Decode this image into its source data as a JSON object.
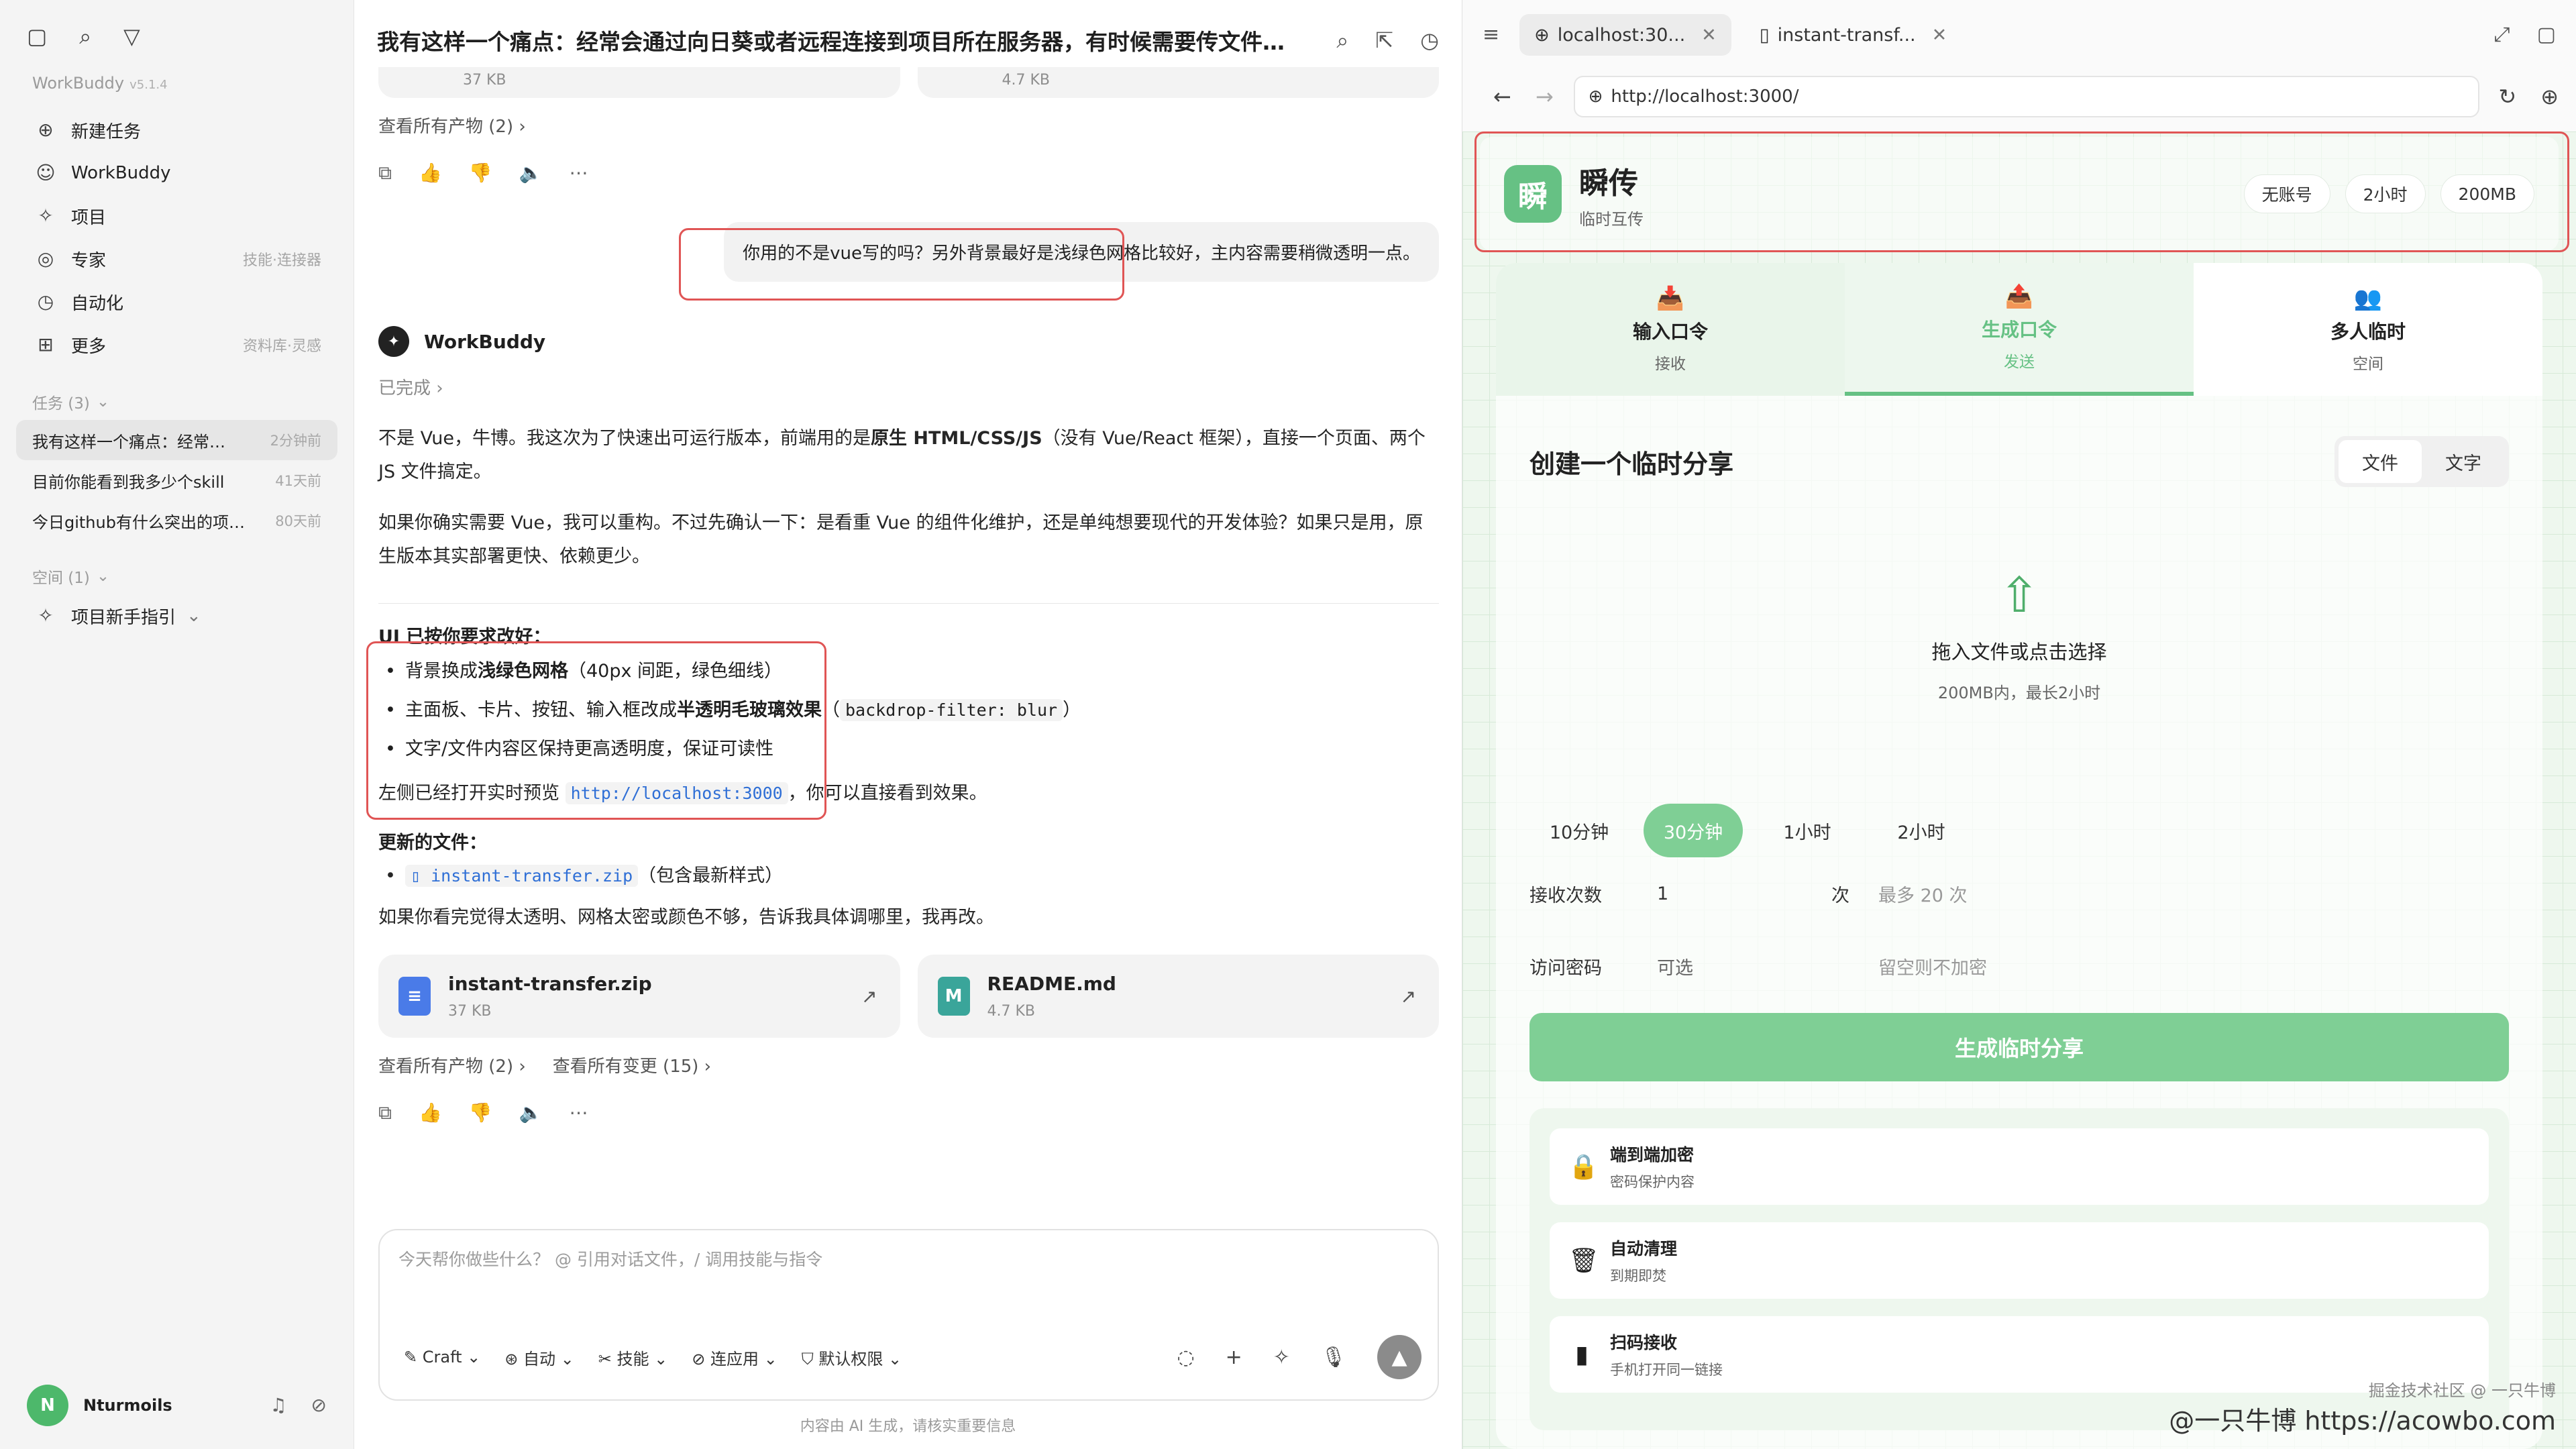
{
  "sidebar": {
    "brand": "WorkBuddy",
    "version": "v5.1.4",
    "nav": [
      {
        "label": "新建任务",
        "meta": ""
      },
      {
        "label": "WorkBuddy",
        "meta": ""
      },
      {
        "label": "项目",
        "meta": ""
      },
      {
        "label": "专家",
        "meta": "技能·连接器"
      },
      {
        "label": "自动化",
        "meta": ""
      },
      {
        "label": "更多",
        "meta": "资料库·灵感"
      }
    ],
    "tasks_header": "任务 (3)",
    "tasks": [
      {
        "title": "我有这样一个痛点：经常…",
        "time": "2分钟前"
      },
      {
        "title": "目前你能看到我多少个skill",
        "time": "41天前"
      },
      {
        "title": "今日github有什么突出的项…",
        "time": "80天前"
      }
    ],
    "space_header": "空间 (1)",
    "space_item": "项目新手指引",
    "user": "Nturmoils"
  },
  "chat": {
    "title": "我有这样一个痛点：经常会通过向日葵或者远程连接到项目所在服务器，有时候需要传文件…",
    "top_files": [
      {
        "size": "37 KB"
      },
      {
        "size": "4.7 KB"
      }
    ],
    "view_artifacts": "查看所有产物 (2)",
    "user_message": "你用的不是vue写的吗？另外背景最好是浅绿色网格比较好，主内容需要稍微透明一点。",
    "bot_name": "WorkBuddy",
    "status": "已完成",
    "p1_a": "不是 Vue，牛博。我这次为了快速出可运行版本，前端用的是",
    "p1_b": "原生 HTML/CSS/JS",
    "p1_c": "（没有 Vue/React 框架），直接一个页面、两个 JS 文件搞定。",
    "p2": "如果你确实需要 Vue，我可以重构。不过先确认一下：是看重 Vue 的组件化维护，还是单纯想要现代的开发体验？如果只是用，原生版本其实部署更快、依赖更少。",
    "ui_head": "UI 已按你要求改好：",
    "b1_a": "背景换成",
    "b1_b": "浅绿色网格",
    "b1_c": "（40px 间距，绿色细线）",
    "b2_a": "主面板、卡片、按钮、输入框改成",
    "b2_b": "半透明毛玻璃效果",
    "b2_c": "（",
    "b2_code": "backdrop-filter: blur",
    "b2_d": "）",
    "b3": "文字/文件内容区保持更高透明度，保证可读性",
    "preview_a": "左侧已经打开实时预览",
    "preview_link": "http://localhost:3000",
    "preview_b": "，你可以直接看到效果。",
    "updated_head": "更新的文件：",
    "updated_file": "instant-transfer.zip",
    "updated_note": "（包含最新样式）",
    "closing": "如果你看完觉得太透明、网格太密或颜色不够，告诉我具体调哪里，我再改。",
    "files": [
      {
        "name": "instant-transfer.zip",
        "size": "37 KB",
        "icon": "zip-file-icon"
      },
      {
        "name": "README.md",
        "size": "4.7 KB",
        "icon": "markdown-file-icon"
      }
    ],
    "view_artifacts2": "查看所有产物 (2)",
    "view_changes": "查看所有变更 (15)",
    "composer_placeholder": "今天帮你做些什么？ @ 引用对话文件，/ 调用技能与指令",
    "composer_opts": [
      "Craft",
      "自动",
      "技能",
      "连应用",
      "默认权限"
    ],
    "disclaimer": "内容由 AI 生成，请核实重要信息"
  },
  "browser": {
    "tabs": [
      "localhost:30...",
      "instant-transf..."
    ],
    "url": "http://localhost:3000/",
    "site": {
      "logo": "瞬",
      "name": "瞬传",
      "sub": "临时互传",
      "pills": [
        "无账号",
        "2小时",
        "200MB"
      ]
    },
    "modes": [
      {
        "label": "输入口令",
        "sub": "接收"
      },
      {
        "label": "生成口令",
        "sub": "发送"
      },
      {
        "label": "多人临时",
        "sub": "空间"
      }
    ],
    "card_title": "创建一个临时分享",
    "seg": [
      "文件",
      "文字"
    ],
    "drop_title": "拖入文件或点击选择",
    "drop_sub": "200MB内，最长2小时",
    "durations": [
      "10分钟",
      "30分钟",
      "1小时",
      "2小时"
    ],
    "count_label": "接收次数",
    "count_value": "1",
    "count_unit": "次",
    "count_hint": "最多 20 次",
    "pwd_label": "访问密码",
    "pwd_placeholder": "可选",
    "pwd_hint": "留空则不加密",
    "generate": "生成临时分享",
    "features": [
      {
        "title": "端到端加密",
        "sub": "密码保护内容"
      },
      {
        "title": "自动清理",
        "sub": "到期即焚"
      },
      {
        "title": "扫码接收",
        "sub": "手机打开同一链接"
      }
    ]
  },
  "watermark": {
    "small": "掘金技术社区 @ 一只牛博",
    "main": "@一只牛博 https://acowbo.com"
  },
  "colors": {
    "accent": "#66c184",
    "highlight": "#e05555"
  }
}
